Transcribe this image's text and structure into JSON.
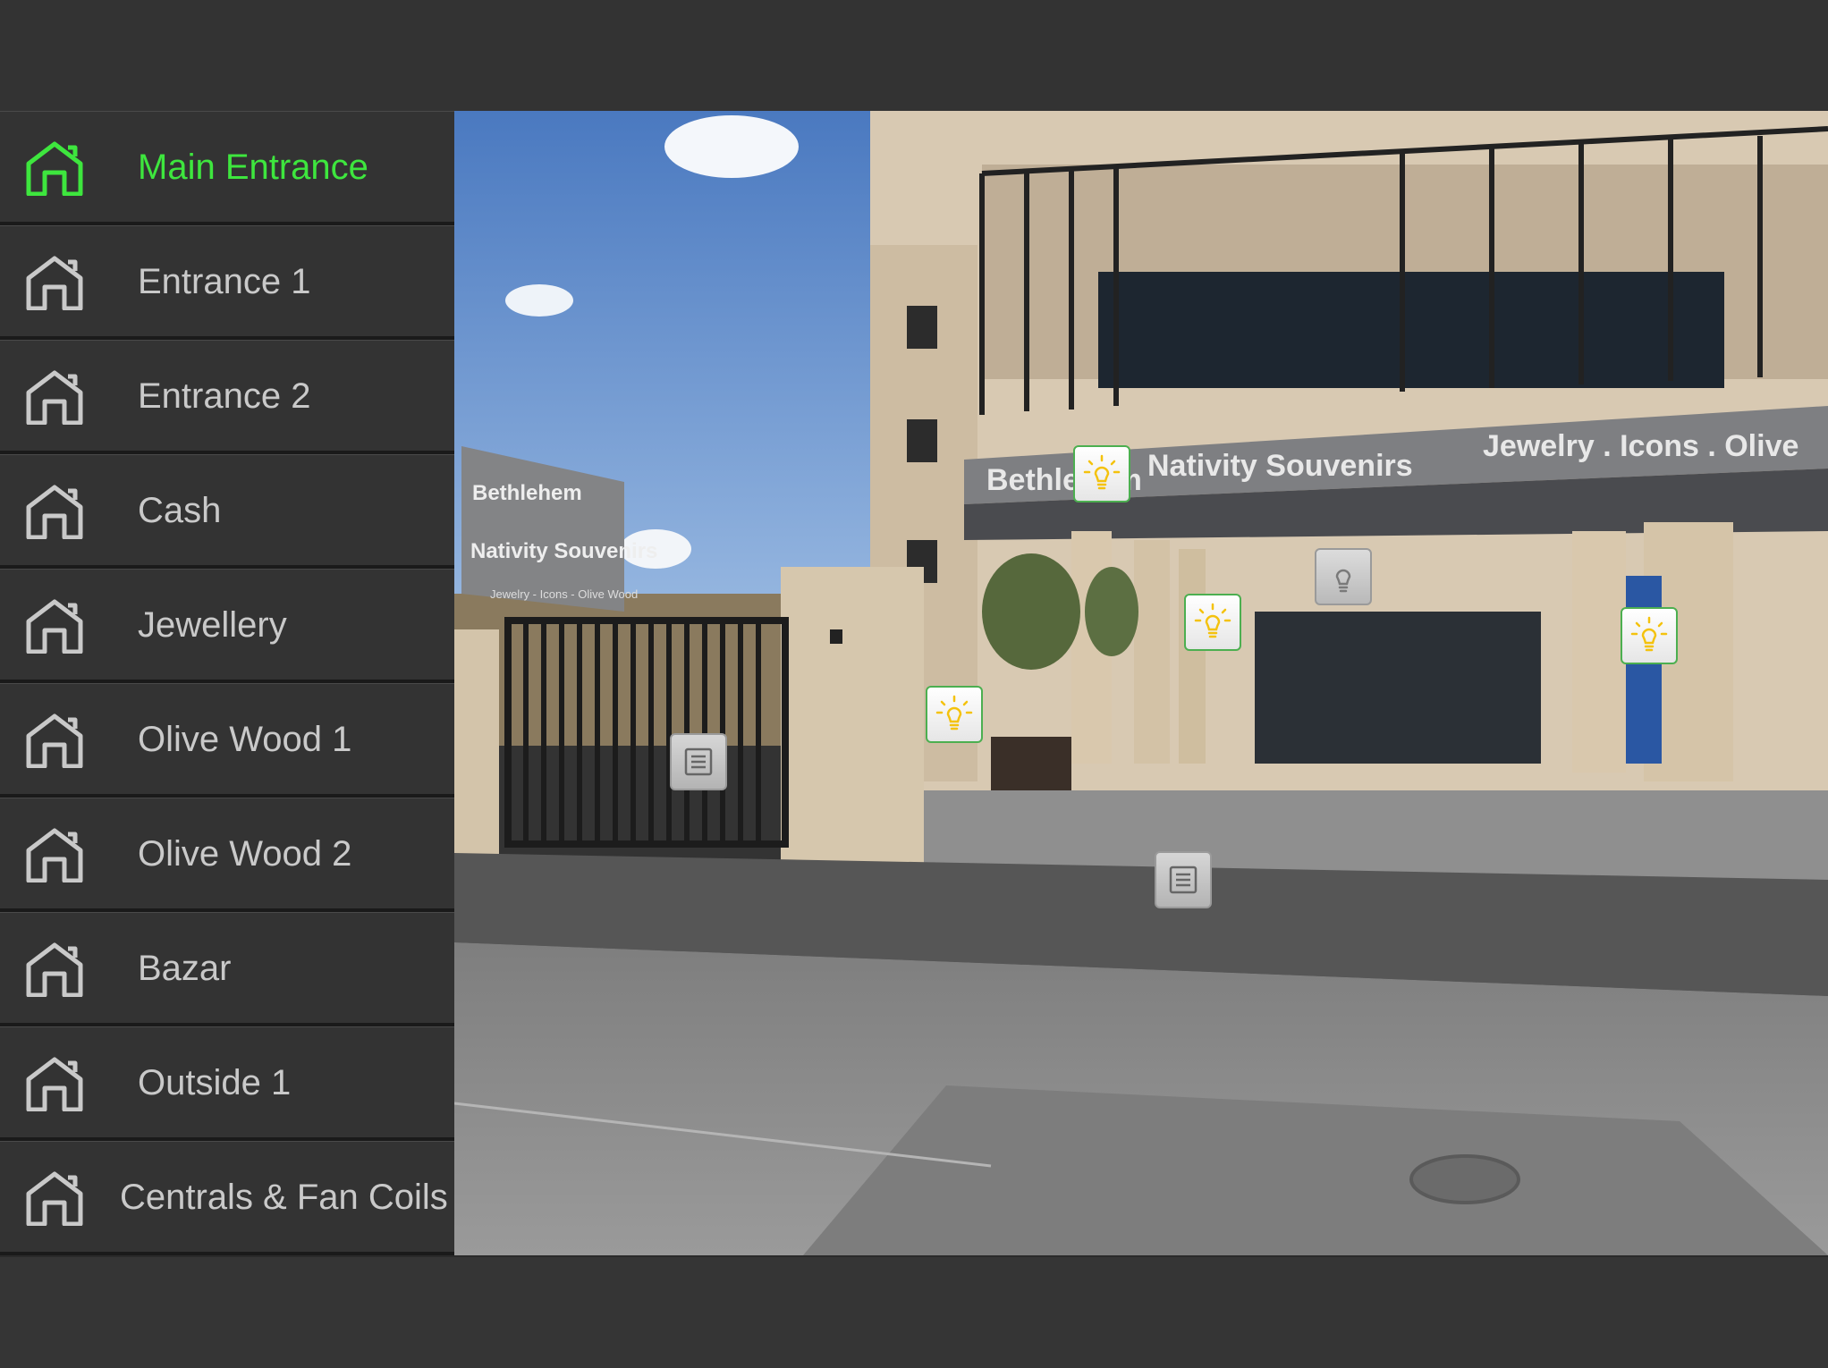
{
  "sidebar": {
    "items": [
      {
        "label": "Main Entrance",
        "active": true,
        "icon": "home-icon"
      },
      {
        "label": "Entrance 1",
        "active": false,
        "icon": "home-icon"
      },
      {
        "label": "Entrance 2",
        "active": false,
        "icon": "home-icon"
      },
      {
        "label": "Cash",
        "active": false,
        "icon": "home-icon"
      },
      {
        "label": "Jewellery",
        "active": false,
        "icon": "home-icon"
      },
      {
        "label": "Olive Wood 1",
        "active": false,
        "icon": "home-icon"
      },
      {
        "label": "Olive Wood 2",
        "active": false,
        "icon": "home-icon"
      },
      {
        "label": "Bazar",
        "active": false,
        "icon": "home-icon"
      },
      {
        "label": "Outside 1",
        "active": false,
        "icon": "home-icon"
      },
      {
        "label": "Centrals & Fan Coils",
        "active": false,
        "icon": "home-icon"
      }
    ]
  },
  "scene": {
    "signage": {
      "building_sign_left": "Bethlehem",
      "building_sign_mid": "Nativity Souvenirs",
      "building_sign_right": "Jewelry . Icons . Olive",
      "pole_sign_line1": "Bethlehem",
      "pole_sign_line2": "Nativity Souvenirs",
      "pole_sign_line3": "Jewelry - Icons - Olive Wood"
    },
    "hotspots": [
      {
        "name": "light-bulb-1",
        "type": "light",
        "state": "on"
      },
      {
        "name": "light-bulb-2",
        "type": "light",
        "state": "off"
      },
      {
        "name": "light-bulb-3",
        "type": "light",
        "state": "on"
      },
      {
        "name": "light-bulb-4",
        "type": "light",
        "state": "on"
      },
      {
        "name": "light-bulb-5",
        "type": "light",
        "state": "on"
      },
      {
        "name": "document-1",
        "type": "document",
        "state": "n/a"
      },
      {
        "name": "document-2",
        "type": "document",
        "state": "n/a"
      }
    ]
  },
  "colors": {
    "active": "#3ee63e",
    "inactive": "#c9c9c9",
    "panel": "#333333",
    "bulb_on": "#f4c20d",
    "bulb_off": "#7a7a7a"
  }
}
